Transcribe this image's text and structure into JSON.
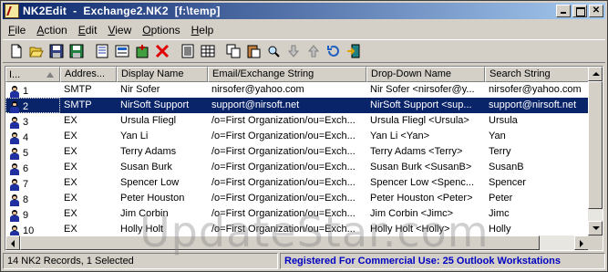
{
  "window": {
    "title": "NK2Edit  -  Exchange2.NK2  [f:\\temp]"
  },
  "menu": [
    {
      "label": "File",
      "u": "F",
      "rest": "ile"
    },
    {
      "label": "Action",
      "u": "A",
      "rest": "ction"
    },
    {
      "label": "Edit",
      "u": "E",
      "rest": "dit"
    },
    {
      "label": "View",
      "u": "V",
      "rest": "iew"
    },
    {
      "label": "Options",
      "u": "O",
      "rest": "ptions"
    },
    {
      "label": "Help",
      "u": "H",
      "rest": "elp"
    }
  ],
  "toolbar": {
    "icons": [
      "new-file-icon",
      "open-folder-icon",
      "save-icon",
      "save-as-icon",
      "properties-icon",
      "copy-record-icon",
      "add-record-icon",
      "delete-icon",
      "html-report-icon",
      "grid-view-icon",
      "copy-icon",
      "paste-icon",
      "find-icon",
      "move-down-icon",
      "move-up-icon",
      "refresh-icon",
      "exit-icon"
    ]
  },
  "columns": [
    "I...",
    "Addres...",
    "Display Name",
    "Email/Exchange String",
    "Drop-Down Name",
    "Search String"
  ],
  "rows": [
    [
      "1",
      "SMTP",
      "Nir Sofer",
      "nirsofer@yahoo.com",
      "Nir Sofer <nirsofer@y...",
      "nirsofer@yahoo.com"
    ],
    [
      "2",
      "SMTP",
      "NirSoft Support",
      "support@nirsoft.net",
      "NirSoft Support <sup...",
      "support@nirsoft.net"
    ],
    [
      "3",
      "EX",
      "Ursula Fliegl",
      "/o=First Organization/ou=Exch...",
      "Ursula Fliegl <Ursula>",
      "Ursula"
    ],
    [
      "4",
      "EX",
      "Yan Li",
      "/o=First Organization/ou=Exch...",
      "Yan Li <Yan>",
      "Yan"
    ],
    [
      "5",
      "EX",
      "Terry Adams",
      "/o=First Organization/ou=Exch...",
      "Terry Adams <Terry>",
      "Terry"
    ],
    [
      "6",
      "EX",
      "Susan Burk",
      "/o=First Organization/ou=Exch...",
      "Susan Burk <SusanB>",
      "SusanB"
    ],
    [
      "7",
      "EX",
      "Spencer Low",
      "/o=First Organization/ou=Exch...",
      "Spencer Low <Spenc...",
      "Spencer"
    ],
    [
      "8",
      "EX",
      "Peter Houston",
      "/o=First Organization/ou=Exch...",
      "Peter Houston <Peter>",
      "Peter"
    ],
    [
      "9",
      "EX",
      "Jim Corbin",
      "/o=First Organization/ou=Exch...",
      "Jim Corbin <Jimc>",
      "Jimc"
    ],
    [
      "10",
      "EX",
      "Holly Holt",
      "/o=First Organization/ou=Exch...",
      "Holly Holt <Holly>",
      "Holly"
    ]
  ],
  "selected_row": 1,
  "status": {
    "left": "14 NK2 Records, 1 Selected",
    "right": "Registered For Commercial Use:  25 Outlook Workstations"
  },
  "watermark": "UpdateStar.com",
  "colors": {
    "title_start": "#0a246a",
    "title_end": "#a6caf0",
    "selection": "#0a246a",
    "status_link": "#0000c0",
    "face": "#d4d0c8"
  }
}
